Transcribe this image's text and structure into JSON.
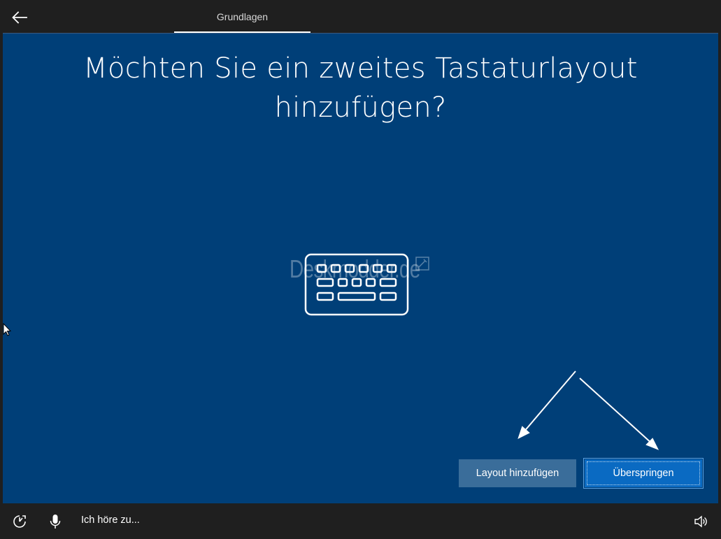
{
  "header": {
    "back_icon": "arrow-left-icon",
    "tab_label": "Grundlagen"
  },
  "main": {
    "title_line1": "Möchten Sie ein zweites Tastaturlayout",
    "title_line2": "hinzufügen?",
    "illustration_icon": "keyboard-icon",
    "watermark": "Deskmodder.de",
    "buttons": {
      "add_layout_label": "Layout hinzufügen",
      "skip_label": "Überspringen"
    }
  },
  "footer": {
    "ease_of_access_icon": "ease-of-access-icon",
    "mic_icon": "microphone-icon",
    "status_text": "Ich höre zu...",
    "volume_icon": "speaker-volume-icon"
  },
  "colors": {
    "background_blue": "#003f78",
    "chrome_dark": "#1f1f1f",
    "primary_button": "#0a6ac2",
    "secondary_button": "#3a6d9a"
  }
}
